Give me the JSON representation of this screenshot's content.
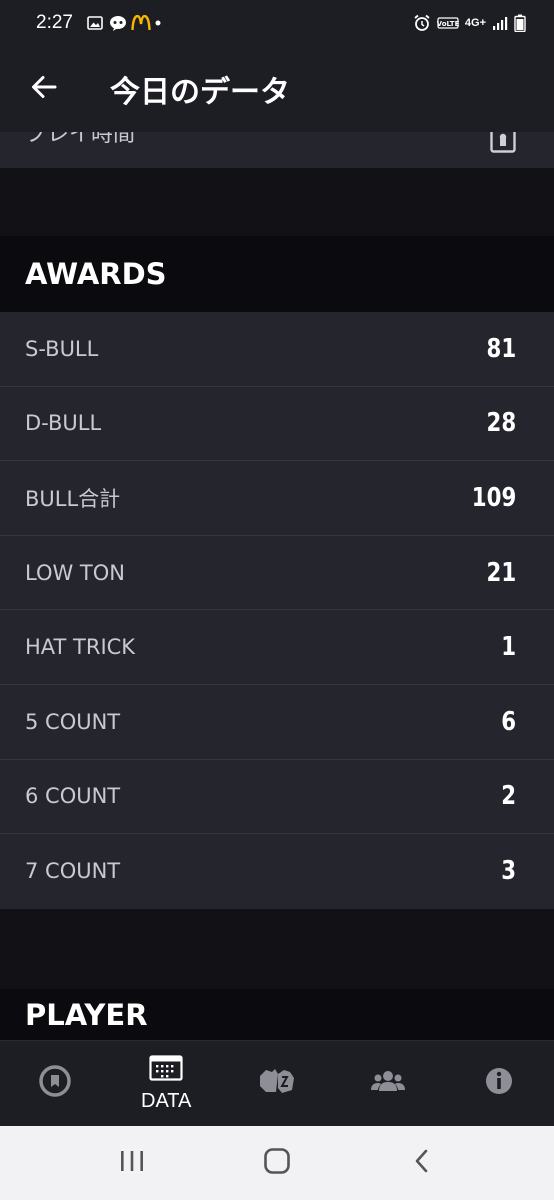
{
  "status_bar": {
    "time": "2:27",
    "network": "4G+",
    "left_icons": [
      "gallery-icon",
      "chat-icon",
      "mcdonalds-icon",
      "dot-icon"
    ],
    "right_icons": [
      "alarm-icon",
      "volte-icon",
      "signal-icon",
      "battery-icon"
    ]
  },
  "header": {
    "title": "今日のデータ",
    "back_icon": "arrow-left-icon"
  },
  "partial_row": {
    "label": "プレイ時間",
    "icon": "lock-icon"
  },
  "awards": {
    "title": "AWARDS",
    "items": [
      {
        "label": "S-BULL",
        "value": "81"
      },
      {
        "label": "D-BULL",
        "value": "28"
      },
      {
        "label": "BULL合計",
        "value": "109"
      },
      {
        "label": "LOW TON",
        "value": "21"
      },
      {
        "label": "HAT TRICK",
        "value": "1"
      },
      {
        "label": "5 COUNT",
        "value": "6"
      },
      {
        "label": "6 COUNT",
        "value": "2"
      },
      {
        "label": "7 COUNT",
        "value": "3"
      }
    ]
  },
  "player": {
    "title": "PLAYER"
  },
  "bottom_nav": {
    "items": [
      {
        "icon": "dartboard-icon",
        "label": ""
      },
      {
        "icon": "calendar-icon",
        "label": "DATA"
      },
      {
        "icon": "versus-icon",
        "label": ""
      },
      {
        "icon": "friends-icon",
        "label": ""
      },
      {
        "icon": "info-icon",
        "label": ""
      }
    ]
  },
  "system_nav": {
    "items": [
      "recents-icon",
      "home-icon",
      "back-icon"
    ]
  }
}
